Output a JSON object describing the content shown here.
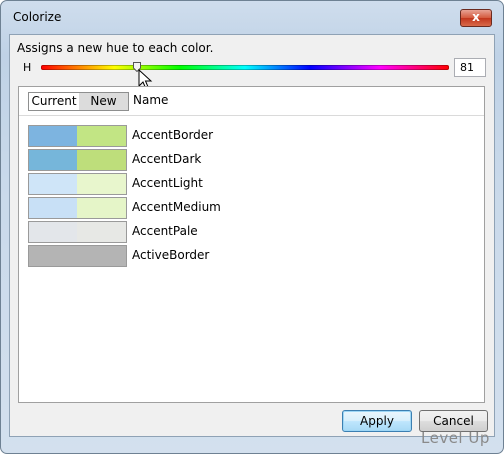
{
  "window": {
    "title": "Colorize",
    "close_glyph": "x"
  },
  "description": "Assigns a new hue to each color.",
  "hue": {
    "label": "H",
    "value": "81",
    "slider_fraction": 0.235
  },
  "columns": {
    "current": "Current",
    "new": "New",
    "name": "Name"
  },
  "colors": [
    {
      "name": "AccentBorder",
      "current": "#7db4e0",
      "new": "#c2e584"
    },
    {
      "name": "AccentDark",
      "current": "#76b6da",
      "new": "#bede7b"
    },
    {
      "name": "AccentLight",
      "current": "#cfe5f8",
      "new": "#e8f6cd"
    },
    {
      "name": "AccentMedium",
      "current": "#c8e0f6",
      "new": "#e5f5c8"
    },
    {
      "name": "AccentPale",
      "current": "#e3e6ea",
      "new": "#e7e8e5"
    },
    {
      "name": "ActiveBorder",
      "current": "#b4b4b4",
      "new": "#b4b4b4"
    }
  ],
  "buttons": {
    "apply": "Apply",
    "cancel": "Cancel"
  },
  "watermark": "Level Up"
}
